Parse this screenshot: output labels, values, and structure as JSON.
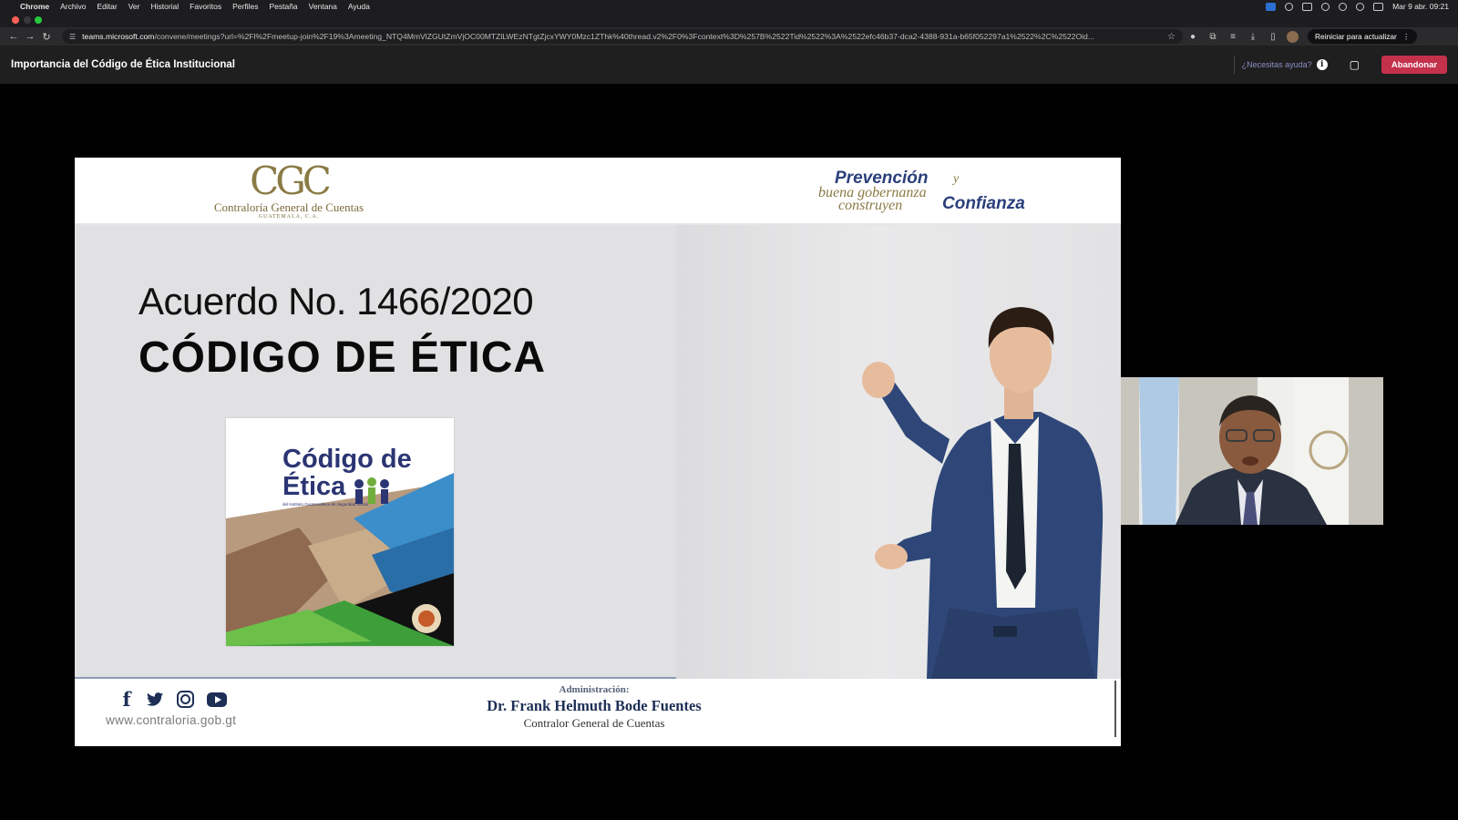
{
  "menubar": {
    "app": "Chrome",
    "menus": [
      "Archivo",
      "Editar",
      "Ver",
      "Historial",
      "Favoritos",
      "Perfiles",
      "Pestaña",
      "Ventana",
      "Ayuda"
    ],
    "clock": "Mar 9 abr.  09:21"
  },
  "browser": {
    "url_host": "teams.microsoft.com",
    "url_path": "/convene/meetings?url=%2Fl%2Fmeetup-join%2F19%3Ameeting_NTQ4MmVlZGUtZmVjOC00MTZlLWEzNTgtZjcxYWY0Mzc1ZThk%40thread.v2%2F0%3Fcontext%3D%257B%2522Tid%2522%3A%2522efc46b37-dca2-4388-931a-b65f052297a1%2522%2C%2522Oid...",
    "update_label": "Reiniciar para actualizar"
  },
  "teams": {
    "meeting_title": "Importancia del Código de Ética Institucional",
    "help_label": "¿Necesitas ayuda?",
    "leave_label": "Abandonar",
    "leave_color": "#c4314b"
  },
  "slide": {
    "logo_mono": "CGC",
    "logo_institution": "Contraloría General de Cuentas",
    "logo_country": "GUATEMALA, C.A.",
    "slogan": {
      "w1": "Prevención",
      "w2": "y",
      "w3": "buena gobernanza",
      "w4": "construyen",
      "w5": "Confianza"
    },
    "agreement": "Acuerdo No. 1466/2020",
    "code_title": "CÓDIGO DE ÉTICA",
    "book": {
      "title_line1": "Código de",
      "title_line2": "Ética",
      "subtitle": "del Instituto Guatemalteco de Seguridad Social"
    },
    "footer": {
      "website": "www.contraloria.gob.gt",
      "admin_label": "Administración:",
      "admin_name": "Dr. Frank Helmuth Bode Fuentes",
      "admin_role": "Contralor General de Cuentas"
    }
  }
}
